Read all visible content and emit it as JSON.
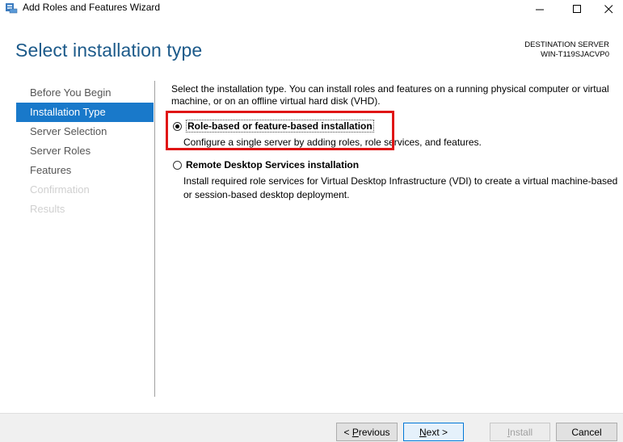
{
  "window": {
    "title": "Add Roles and Features Wizard",
    "minimize": "—",
    "maximize": "☐",
    "close": "✕"
  },
  "header": {
    "page_title": "Select installation type",
    "destination_label": "DESTINATION SERVER",
    "destination_server": "WIN-T119SJACVP0"
  },
  "nav": {
    "items": [
      {
        "label": "Before You Begin",
        "state": "normal"
      },
      {
        "label": "Installation Type",
        "state": "active"
      },
      {
        "label": "Server Selection",
        "state": "normal"
      },
      {
        "label": "Server Roles",
        "state": "normal"
      },
      {
        "label": "Features",
        "state": "normal"
      },
      {
        "label": "Confirmation",
        "state": "disabled"
      },
      {
        "label": "Results",
        "state": "disabled"
      }
    ]
  },
  "main": {
    "intro": "Select the installation type. You can install roles and features on a running physical computer or virtual machine, or on an offline virtual hard disk (VHD).",
    "options": [
      {
        "label": "Role-based or feature-based installation",
        "description": "Configure a single server by adding roles, role services, and features.",
        "selected": true
      },
      {
        "label": "Remote Desktop Services installation",
        "description": "Install required role services for Virtual Desktop Infrastructure (VDI) to create a virtual machine-based or session-based desktop deployment.",
        "selected": false
      }
    ]
  },
  "footer": {
    "previous": {
      "prefix": "< ",
      "accel": "P",
      "rest": "revious"
    },
    "next": {
      "accel": "N",
      "rest": "ext >"
    },
    "install": {
      "accel": "I",
      "rest": "nstall"
    },
    "cancel": "Cancel"
  },
  "colors": {
    "accent": "#1979ca",
    "title": "#1c5a8a",
    "highlight": "#e01515"
  }
}
